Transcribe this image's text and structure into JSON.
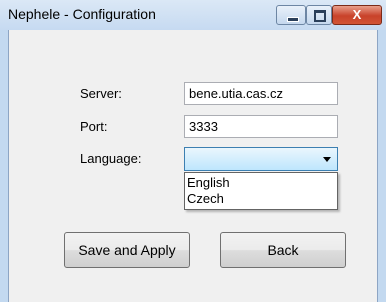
{
  "window": {
    "title": "Nephele - Configuration",
    "controls": {
      "minimize_icon": "minimize-icon",
      "maximize_icon": "maximize-icon",
      "close_label": "X"
    }
  },
  "form": {
    "server_label": "Server:",
    "server_value": "bene.utia.cas.cz",
    "port_label": "Port:",
    "port_value": "3333",
    "language_label": "Language:",
    "language_value": "",
    "language_options": [
      "English",
      "Czech"
    ]
  },
  "buttons": {
    "save_apply": "Save and Apply",
    "back": "Back"
  },
  "colors": {
    "title_bar": "#c6daf1",
    "close_button": "#c8422a",
    "combo_focus": "#3c7fb1",
    "client_bg": "#f0f0f0"
  }
}
